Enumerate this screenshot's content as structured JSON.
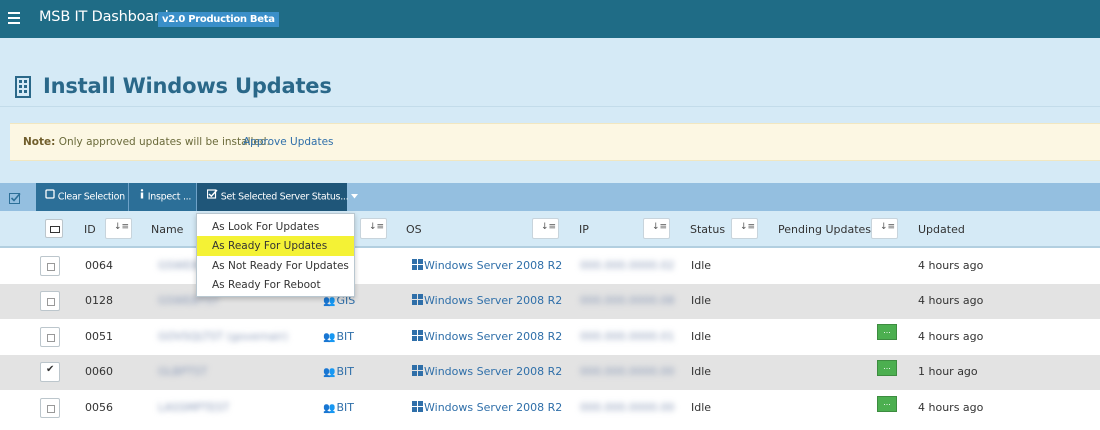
{
  "topbar": {
    "title": "MSB IT Dashboard",
    "version": "v2.0 Production Beta"
  },
  "page": {
    "title": "Install Windows Updates"
  },
  "note": {
    "label": "Note:",
    "text": "Only approved updates will be installed.",
    "link": "Approve Updates"
  },
  "toolbar": {
    "clear_selection": "Clear Selection",
    "inspect": "Inspect ...",
    "set_status": "Set Selected Server Status..."
  },
  "status_menu": {
    "items": [
      "As Look For Updates",
      "As Ready For Updates",
      "As Not Ready For Updates",
      "As Ready For Reboot"
    ],
    "highlighted": "As Ready For Updates",
    "highlight_color": "#f4f235"
  },
  "table": {
    "columns": {
      "id": "ID",
      "name": "Name",
      "os": "OS",
      "ip": "IP",
      "status": "Status",
      "pending": "Pending Updates",
      "updated": "Updated"
    },
    "sort_icon": "sort-amount-icon",
    "rows": [
      {
        "id": "0064",
        "name": "GSWEB01",
        "group": "",
        "os": "Windows Server 2008 R2",
        "ip": "000.000.0000.02",
        "status": "Idle",
        "pending": "",
        "updated": "4 hours ago",
        "checked": false
      },
      {
        "id": "0128",
        "name": "GSWEBTST",
        "group": "GIS",
        "os": "Windows Server 2008 R2",
        "ip": "000.000.0000.08",
        "status": "Idle",
        "pending": "",
        "updated": "4 hours ago",
        "checked": false
      },
      {
        "id": "0051",
        "name": "GOVSQLTST (governair)",
        "group": "BIT",
        "os": "Windows Server 2008 R2",
        "ip": "000.000.0000.01",
        "status": "Idle",
        "pending": "...",
        "updated": "4 hours ago",
        "checked": false
      },
      {
        "id": "0060",
        "name": "GLBPTST",
        "group": "BIT",
        "os": "Windows Server 2008 R2",
        "ip": "000.000.0000.00",
        "status": "Idle",
        "pending": "...",
        "updated": "1 hour ago",
        "checked": true
      },
      {
        "id": "0056",
        "name": "LASSMPTEST",
        "group": "BIT",
        "os": "Windows Server 2008 R2",
        "ip": "000.000.0000.00",
        "status": "Idle",
        "pending": "...",
        "updated": "4 hours ago",
        "checked": false
      }
    ]
  },
  "colors": {
    "topbar": "#1f6c86",
    "header_bg": "#d5eaf6",
    "toolbar": "#94bfe0",
    "button": "#2c6f98",
    "link": "#2f6fa9",
    "pending_button": "#4caf50",
    "note_bg": "#fcf7e3"
  }
}
